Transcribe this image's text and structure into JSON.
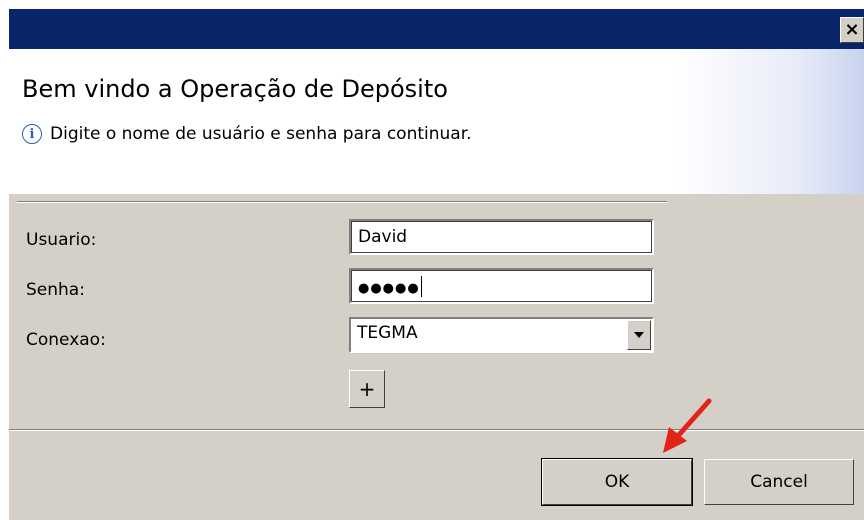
{
  "window": {
    "close_glyph": "×"
  },
  "header": {
    "title": "Bem vindo a Operação de Depósito",
    "info_text": "Digite o nome de usuário e senha para continuar.",
    "info_icon": "info-icon"
  },
  "form": {
    "user_label": "Usuario:",
    "user_value": "David",
    "password_label": "Senha:",
    "password_mask": "●●●●●",
    "connection_label": "Conexao:",
    "connection_value": "TEGMA",
    "add_connection_label": "+"
  },
  "buttons": {
    "ok_label": "OK",
    "cancel_label": "Cancel"
  },
  "colors": {
    "titlebar": "#0a246a",
    "dialog_bg": "#d4d0c8",
    "annotation_arrow": "#e2231a"
  }
}
